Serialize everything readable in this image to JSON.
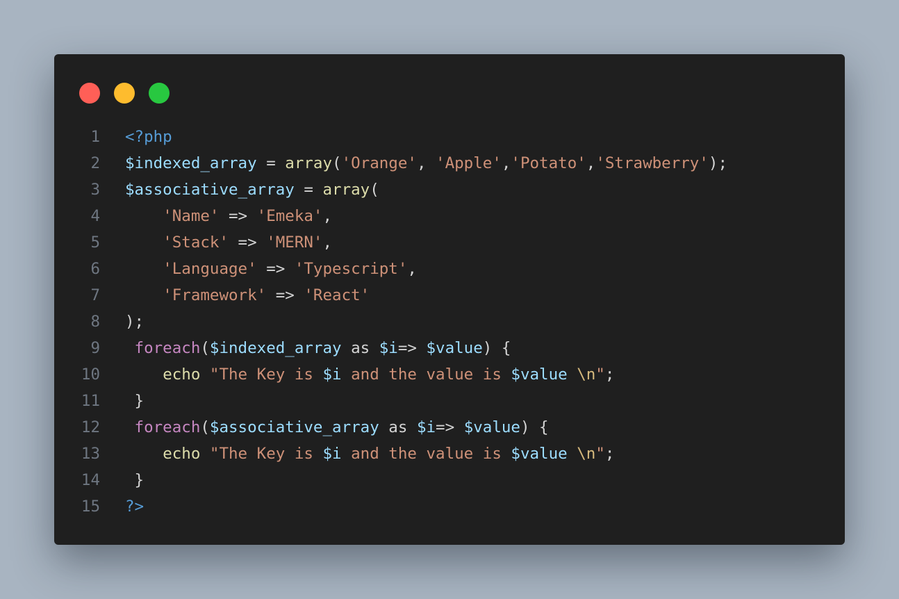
{
  "window": {
    "controls": [
      {
        "name": "close-dot",
        "color": "#ff5f57"
      },
      {
        "name": "minimize-dot",
        "color": "#febc2e"
      },
      {
        "name": "maximize-dot",
        "color": "#28c840"
      }
    ]
  },
  "colors": {
    "background": "#a8b4c1",
    "editor_background": "#1f1f1f",
    "line_number": "#6e7681",
    "keyword": "#569cd6",
    "variable": "#9cdcfe",
    "function": "#dcdcaa",
    "string": "#ce9178",
    "control": "#c586c0",
    "punctuation": "#d4d4d4"
  },
  "code": {
    "language": "php",
    "lines": [
      {
        "number": "1",
        "tokens": [
          {
            "t": "<?php",
            "k": "keyword"
          }
        ]
      },
      {
        "number": "2",
        "tokens": [
          {
            "t": "$indexed_array",
            "k": "variable"
          },
          {
            "t": " = ",
            "k": "punct"
          },
          {
            "t": "array",
            "k": "function"
          },
          {
            "t": "(",
            "k": "punct"
          },
          {
            "t": "'Orange'",
            "k": "string"
          },
          {
            "t": ", ",
            "k": "punct"
          },
          {
            "t": "'Apple'",
            "k": "string"
          },
          {
            "t": ",",
            "k": "punct"
          },
          {
            "t": "'Potato'",
            "k": "string"
          },
          {
            "t": ",",
            "k": "punct"
          },
          {
            "t": "'Strawberry'",
            "k": "string"
          },
          {
            "t": ");",
            "k": "punct"
          }
        ]
      },
      {
        "number": "3",
        "tokens": [
          {
            "t": "$associative_array",
            "k": "variable"
          },
          {
            "t": " = ",
            "k": "punct"
          },
          {
            "t": "array",
            "k": "function"
          },
          {
            "t": "(",
            "k": "punct"
          }
        ]
      },
      {
        "number": "4",
        "tokens": [
          {
            "t": "    ",
            "k": "plain"
          },
          {
            "t": "'Name'",
            "k": "string"
          },
          {
            "t": " => ",
            "k": "punct"
          },
          {
            "t": "'Emeka'",
            "k": "string"
          },
          {
            "t": ",",
            "k": "punct"
          }
        ]
      },
      {
        "number": "5",
        "tokens": [
          {
            "t": "    ",
            "k": "plain"
          },
          {
            "t": "'Stack'",
            "k": "string"
          },
          {
            "t": " => ",
            "k": "punct"
          },
          {
            "t": "'MERN'",
            "k": "string"
          },
          {
            "t": ",",
            "k": "punct"
          }
        ]
      },
      {
        "number": "6",
        "tokens": [
          {
            "t": "    ",
            "k": "plain"
          },
          {
            "t": "'Language'",
            "k": "string"
          },
          {
            "t": " => ",
            "k": "punct"
          },
          {
            "t": "'Typescript'",
            "k": "string"
          },
          {
            "t": ",",
            "k": "punct"
          }
        ]
      },
      {
        "number": "7",
        "tokens": [
          {
            "t": "    ",
            "k": "plain"
          },
          {
            "t": "'Framework'",
            "k": "string"
          },
          {
            "t": " => ",
            "k": "punct"
          },
          {
            "t": "'React'",
            "k": "string"
          }
        ]
      },
      {
        "number": "8",
        "tokens": [
          {
            "t": ");",
            "k": "punct"
          }
        ]
      },
      {
        "number": "9",
        "tokens": [
          {
            "t": " ",
            "k": "plain"
          },
          {
            "t": "foreach",
            "k": "control"
          },
          {
            "t": "(",
            "k": "punct"
          },
          {
            "t": "$indexed_array",
            "k": "variable"
          },
          {
            "t": " as ",
            "k": "punct"
          },
          {
            "t": "$i",
            "k": "variable"
          },
          {
            "t": "=> ",
            "k": "punct"
          },
          {
            "t": "$value",
            "k": "variable"
          },
          {
            "t": ") {",
            "k": "punct"
          }
        ]
      },
      {
        "number": "10",
        "tokens": [
          {
            "t": "    ",
            "k": "plain"
          },
          {
            "t": "echo",
            "k": "function"
          },
          {
            "t": " ",
            "k": "plain"
          },
          {
            "t": "\"The Key is ",
            "k": "string"
          },
          {
            "t": "$i",
            "k": "variable"
          },
          {
            "t": " and the value is ",
            "k": "string"
          },
          {
            "t": "$value",
            "k": "variable"
          },
          {
            "t": " ",
            "k": "string"
          },
          {
            "t": "\\n",
            "k": "escape"
          },
          {
            "t": "\"",
            "k": "string"
          },
          {
            "t": ";",
            "k": "punct"
          }
        ]
      },
      {
        "number": "11",
        "tokens": [
          {
            "t": " }",
            "k": "punct"
          }
        ]
      },
      {
        "number": "12",
        "tokens": [
          {
            "t": " ",
            "k": "plain"
          },
          {
            "t": "foreach",
            "k": "control"
          },
          {
            "t": "(",
            "k": "punct"
          },
          {
            "t": "$associative_array",
            "k": "variable"
          },
          {
            "t": " as ",
            "k": "punct"
          },
          {
            "t": "$i",
            "k": "variable"
          },
          {
            "t": "=> ",
            "k": "punct"
          },
          {
            "t": "$value",
            "k": "variable"
          },
          {
            "t": ") {",
            "k": "punct"
          }
        ]
      },
      {
        "number": "13",
        "tokens": [
          {
            "t": "    ",
            "k": "plain"
          },
          {
            "t": "echo",
            "k": "function"
          },
          {
            "t": " ",
            "k": "plain"
          },
          {
            "t": "\"The Key is ",
            "k": "string"
          },
          {
            "t": "$i",
            "k": "variable"
          },
          {
            "t": " and the value is ",
            "k": "string"
          },
          {
            "t": "$value",
            "k": "variable"
          },
          {
            "t": " ",
            "k": "string"
          },
          {
            "t": "\\n",
            "k": "escape"
          },
          {
            "t": "\"",
            "k": "string"
          },
          {
            "t": ";",
            "k": "punct"
          }
        ]
      },
      {
        "number": "14",
        "tokens": [
          {
            "t": " }",
            "k": "punct"
          }
        ]
      },
      {
        "number": "15",
        "tokens": [
          {
            "t": "?>",
            "k": "keyword"
          }
        ]
      }
    ]
  }
}
